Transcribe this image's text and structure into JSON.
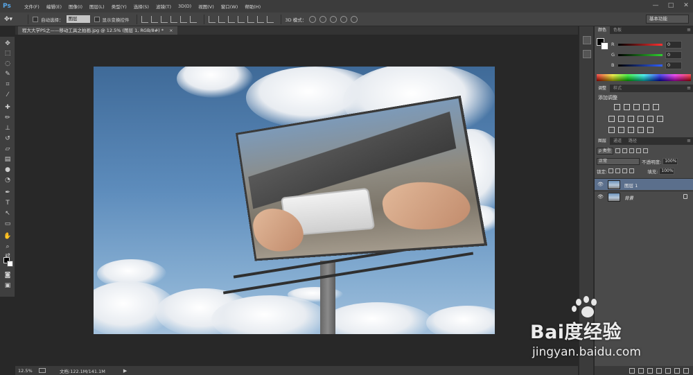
{
  "app": {
    "logo_text": "Ps",
    "menu": [
      "文件(F)",
      "编辑(E)",
      "图像(I)",
      "图层(L)",
      "类型(Y)",
      "选择(S)",
      "滤镜(T)",
      "3D(D)",
      "视图(V)",
      "窗口(W)",
      "帮助(H)"
    ],
    "window_controls": [
      "—",
      "□",
      "✕"
    ]
  },
  "options": {
    "auto_select_label": "自动选择：",
    "auto_select_value": "图层",
    "show_transform_label": "显示变换控件",
    "mode_3d_label": "3D 模式：",
    "workspace": "基本功能"
  },
  "document": {
    "tab_title": "程大大学PS之——移动工具之拍画.jpg @ 12.5% (图层 1, RGB/8#) *",
    "tab_close": "×",
    "zoom": "12.5%",
    "doc_info": "文档:122.1M/141.1M",
    "status_arrow": "▶"
  },
  "panels": {
    "color_tabs": [
      "颜色",
      "色板"
    ],
    "channels": [
      {
        "label": "R",
        "value": "0",
        "color": "#ff3030"
      },
      {
        "label": "G",
        "value": "0",
        "color": "#30d030"
      },
      {
        "label": "B",
        "value": "0",
        "color": "#3060ff"
      }
    ],
    "adjust_tabs": [
      "调整",
      "样式"
    ],
    "adjust_title": "添加调整",
    "layers_tabs": [
      "图层",
      "通道",
      "路径"
    ],
    "filter_kind": "ρ 类型",
    "blend_mode": "正常",
    "opacity_label": "不透明度:",
    "opacity_value": "100%",
    "lock_label": "锁定:",
    "fill_label": "填充:",
    "fill_value": "100%",
    "layers": [
      {
        "name": "图层 1",
        "selected": true
      },
      {
        "name": "背景",
        "selected": false,
        "locked": true
      }
    ],
    "panel_menu": "≡"
  },
  "watermark": {
    "brand": "Bai度经验",
    "url": "jingyan.baidu.com"
  },
  "icons": {
    "eye": "👁"
  }
}
